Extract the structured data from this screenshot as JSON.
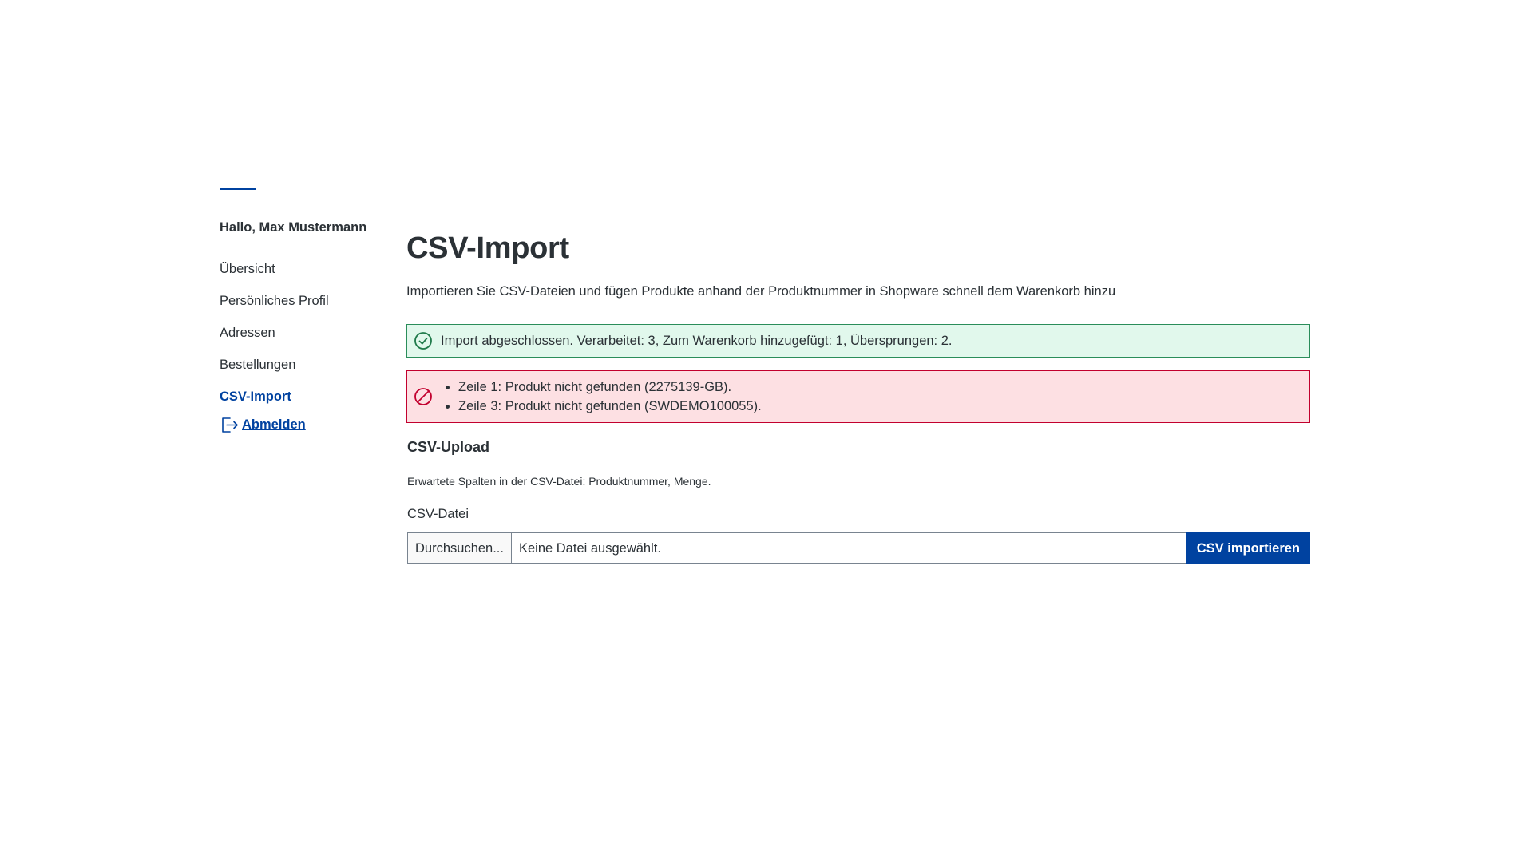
{
  "sidebar": {
    "greeting": "Hallo, Max Mustermann",
    "items": [
      {
        "label": "Übersicht"
      },
      {
        "label": "Persönliches Profil"
      },
      {
        "label": "Adressen"
      },
      {
        "label": "Bestellungen"
      },
      {
        "label": "CSV-Import"
      }
    ],
    "active_item": "CSV-Import",
    "logout": {
      "label": "Abmelden",
      "icon": "logout-icon"
    }
  },
  "main": {
    "title": "CSV-Import",
    "description": "Importieren Sie CSV-Dateien und fügen Produkte anhand der Produktnummer in Shopware schnell dem Warenkorb hinzu",
    "success_alert": {
      "icon": "check-circle-icon",
      "text": "Import abgeschlossen. Verarbeitet: 3, Zum Warenkorb hinzugefügt: 1, Übersprungen: 2."
    },
    "error_alert": {
      "icon": "blocked-icon",
      "items": [
        "Zeile 1: Produkt nicht gefunden (2275139-GB).",
        "Zeile 3: Produkt nicht gefunden (SWDEMO100055)."
      ]
    },
    "upload": {
      "section_title": "CSV-Upload",
      "hint": "Erwartete Spalten in der CSV-Datei: Produktnummer, Menge.",
      "file_label": "CSV-Datei",
      "browse_label": "Durchsuchen...",
      "file_status": "Keine Datei ausgewählt.",
      "submit_label": "CSV importieren"
    }
  },
  "colors": {
    "accent": "#0042a0",
    "success_bg": "#e1f8ec",
    "success_border": "#2a8d5a",
    "danger_bg": "#fde0e3",
    "danger_border": "#c2002e"
  }
}
